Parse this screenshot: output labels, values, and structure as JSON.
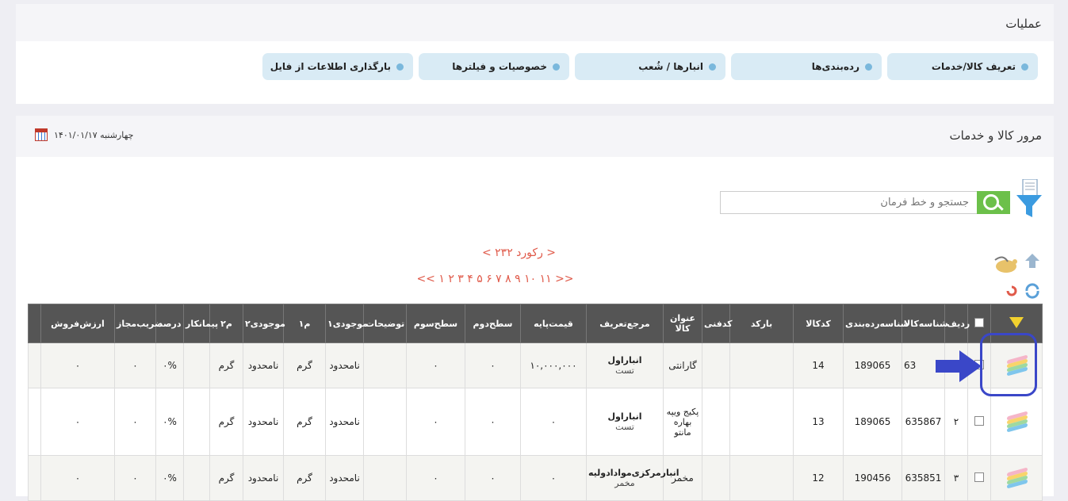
{
  "operations": {
    "title": "عملیات",
    "tabs": [
      {
        "label": "تعریف کالا/خدمات"
      },
      {
        "label": "رده‌بندی‌ها"
      },
      {
        "label": "انبارها / شُعب"
      },
      {
        "label": "خصوصیات و فیلترها"
      },
      {
        "label": "بارگذاری اطلاعات از فایل"
      }
    ]
  },
  "browse": {
    "title": "مرور کالا و خدمات",
    "date": "چهارشنبه ۱۴۰۱/۰۱/۱۷",
    "search_placeholder": "جستجو و خط فرمان",
    "records": "< ۲۳۲ رکورد >",
    "pages": "<< ۱ ۲ ۳ ۴ ۵ ۶ ۷ ۸ ۹ ۱۰ ۱۱ >>"
  },
  "table": {
    "headers": [
      "ردیف",
      "شناسه‌کالا",
      "شناسه‌رده‌بندی",
      "کدکالا",
      "بارکد",
      "کدفنی",
      "عنوان کالا",
      "مرجع‌تعریف",
      "قیمت‌پایه",
      "سطح‌دوم",
      "سطح‌سوم",
      "توضیحات",
      "موجودی۱",
      "م۱",
      "موجودی۲",
      "م۲",
      "پیمانکار",
      "درصد",
      "ضریب‌مجاز",
      "ارزش‌فروش"
    ],
    "rows": [
      {
        "radif": "",
        "id": "63",
        "cat": "189065",
        "code": "14",
        "barcode": "",
        "tech": "",
        "name": "گارانتی",
        "ref_main": "انباراول",
        "ref_sub": "تست",
        "price": "۱۰,۰۰۰,۰۰۰",
        "l2": "۰",
        "l3": "۰",
        "desc": "",
        "inv1": "نامحدود",
        "u1": "گرم",
        "inv2": "نامحدود",
        "u2": "گرم",
        "contractor": "",
        "percent": "۰%",
        "coef": "۰",
        "value": "۰"
      },
      {
        "radif": "۲",
        "id": "635867",
        "cat": "189065",
        "code": "13",
        "barcode": "",
        "tech": "",
        "name": "پکیج ویپه بهاره مانتو",
        "ref_main": "انباراول",
        "ref_sub": "تست",
        "price": "۰",
        "l2": "۰",
        "l3": "۰",
        "desc": "",
        "inv1": "نامحدود",
        "u1": "گرم",
        "inv2": "نامحدود",
        "u2": "گرم",
        "contractor": "",
        "percent": "۰%",
        "coef": "۰",
        "value": "۰"
      },
      {
        "radif": "۳",
        "id": "635851",
        "cat": "190456",
        "code": "12",
        "barcode": "",
        "tech": "",
        "name": "مخمر",
        "ref_main": "انبارمرکزی‌موادادولیه",
        "ref_sub": "مخمر",
        "price": "۰",
        "l2": "۰",
        "l3": "۰",
        "desc": "",
        "inv1": "نامحدود",
        "u1": "گرم",
        "inv2": "نامحدود",
        "u2": "گرم",
        "contractor": "",
        "percent": "۰%",
        "coef": "۰",
        "value": "۰"
      }
    ]
  }
}
